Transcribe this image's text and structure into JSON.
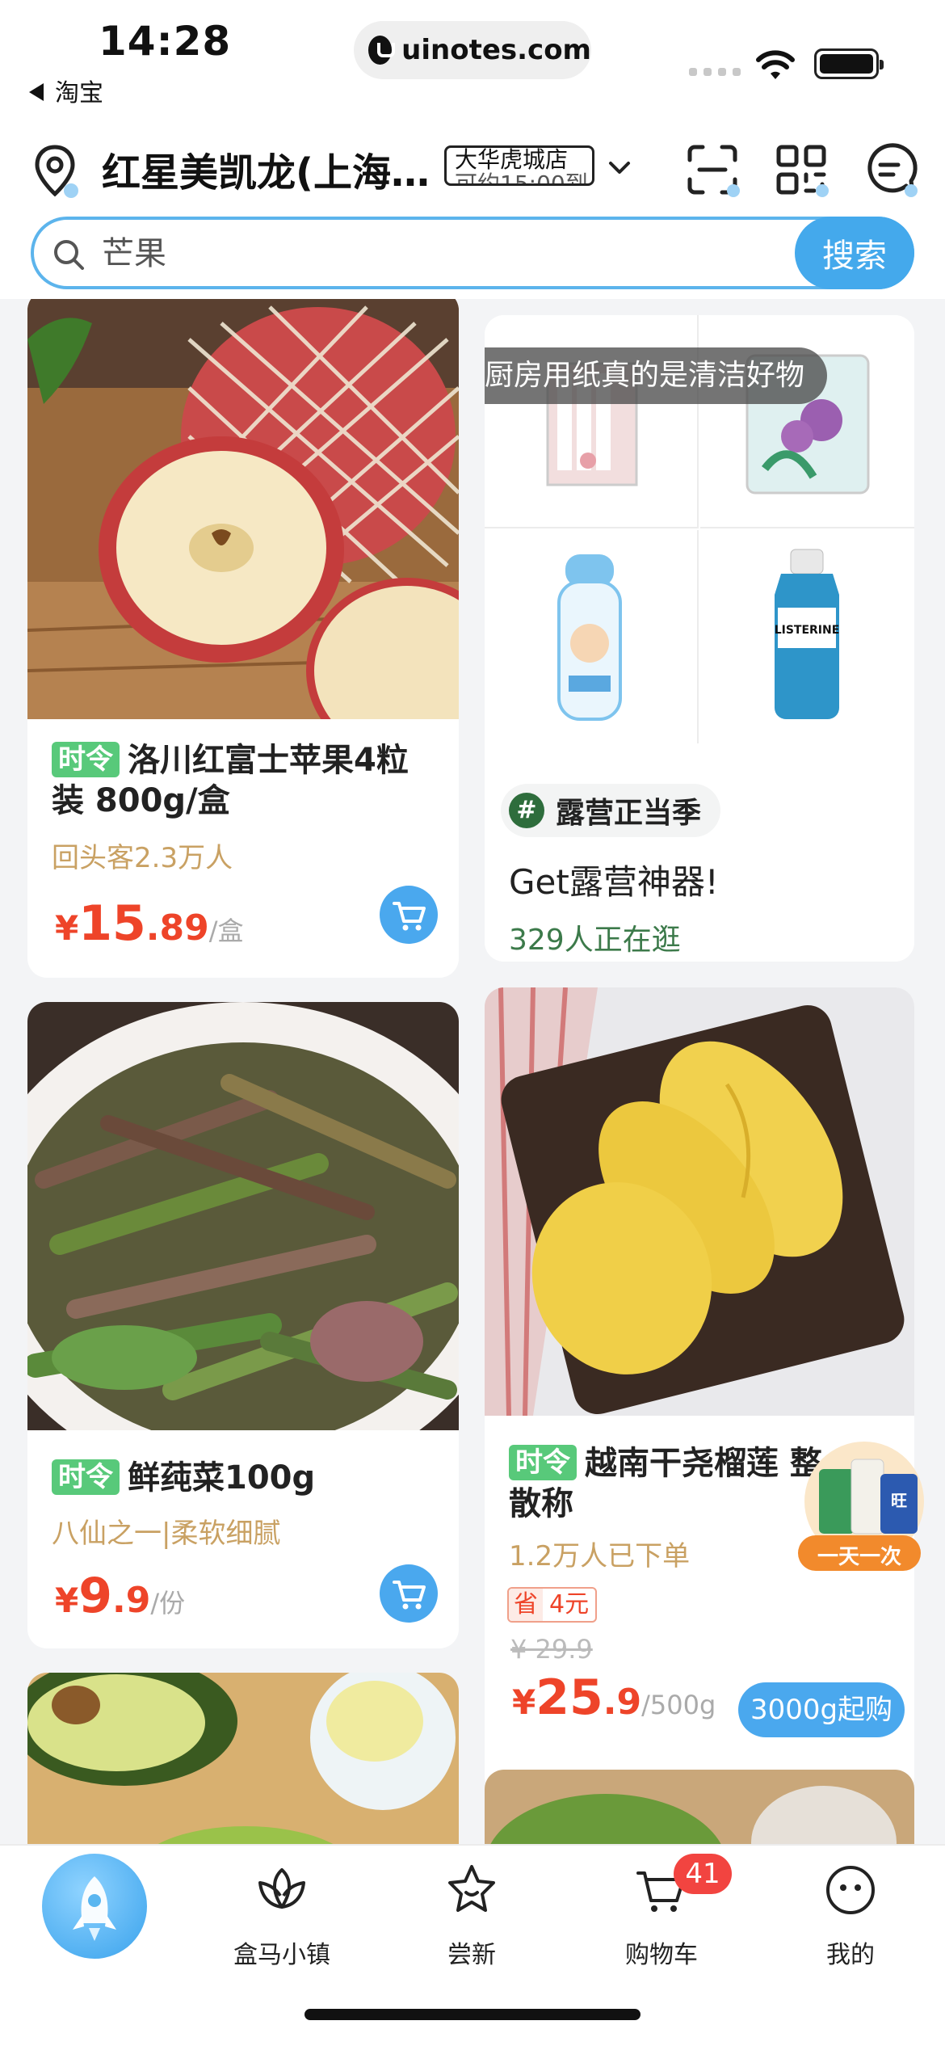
{
  "status_bar": {
    "time": "14:28",
    "back_app": "淘宝",
    "url": "uinotes.com"
  },
  "header": {
    "store_name": "红星美凯龙(上海…",
    "store_badge_line1": "大华虎城店",
    "store_badge_line2": "可约15:00到",
    "search_placeholder": "芒果",
    "search_button": "搜索"
  },
  "products": [
    {
      "tag": "时令",
      "title": "洛川红富士苹果4粒装 800g/盒",
      "subtitle": "回头客2.3万人",
      "currency": "¥",
      "price_int": "15",
      "price_dec": ".89",
      "unit": "/盒"
    },
    {
      "tag": "时令",
      "title": "鲜莼菜100g",
      "subtitle": "八仙之一|柔软细腻",
      "currency": "¥",
      "price_int": "9",
      "price_dec": ".9",
      "unit": "/份"
    },
    {
      "tag": "时令",
      "title": "越南干尧榴莲 整 散称",
      "subtitle": "1.2万人已下单",
      "save_label": "省",
      "save_amount": "4元",
      "original_price": "¥ 29.9",
      "currency": "¥",
      "price_int": "25",
      "price_dec": ".9",
      "unit": "/500g",
      "min_order": "3000g起购",
      "floating_badge": "一天一次"
    }
  ],
  "promo": {
    "ticker": "厨房用纸真的是清洁好物",
    "topic": "露营正当季",
    "title": "Get露营神器!",
    "browsing": "329人正在逛",
    "grid_item_label": "LISTERINE"
  },
  "tabbar": {
    "tabs": [
      "盒马小镇",
      "尝新",
      "购物车",
      "我的"
    ],
    "cart_count": "41"
  },
  "colors": {
    "accent": "#44a9ec",
    "price": "#ee4429",
    "tag_green": "#58c97a",
    "subtitle_gold": "#c9a163"
  }
}
